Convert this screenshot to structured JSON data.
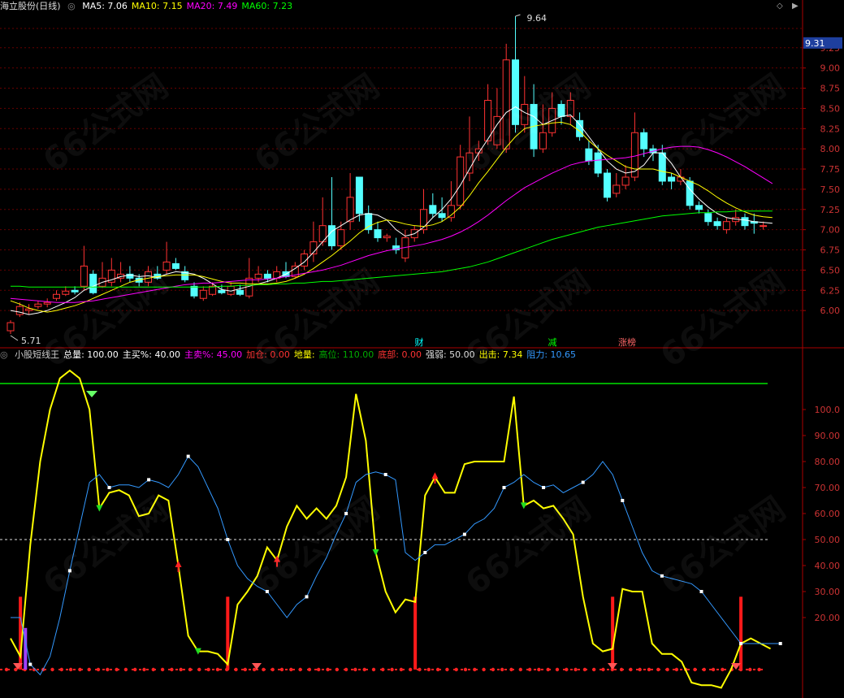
{
  "top_header": {
    "title": "海立股份(日线)",
    "ma_items": [
      {
        "label": "MA5: 7.06",
        "color": "#ffffff"
      },
      {
        "label": "MA10: 7.15",
        "color": "#ffff00"
      },
      {
        "label": "MA20: 7.49",
        "color": "#ff00ff"
      },
      {
        "label": "MA60: 7.23",
        "color": "#00ff00"
      }
    ]
  },
  "bottom_header": {
    "items": [
      {
        "label": "小股短线王",
        "color": "#cccccc"
      },
      {
        "label": "总量: 100.00",
        "color": "#ffffff"
      },
      {
        "label": "主买%: 40.00",
        "color": "#ffffff"
      },
      {
        "label": "主卖%: 45.00",
        "color": "#ff00ff"
      },
      {
        "label": "加仓: 0.00",
        "color": "#ff3333"
      },
      {
        "label": "地量:",
        "color": "#ffff00"
      },
      {
        "label": "高位: 110.00",
        "color": "#00aa00"
      },
      {
        "label": "底部: 0.00",
        "color": "#ff3333"
      },
      {
        "label": "强弱: 50.00",
        "color": "#dddddd"
      },
      {
        "label": "出击: 7.34",
        "color": "#ffff00"
      },
      {
        "label": "阻力: 10.65",
        "color": "#3399ff"
      }
    ]
  },
  "icons": {
    "diamond": "diamond-icon",
    "scroll_right": "scroll-right-icon",
    "circle": "circle-icon"
  },
  "watermark": "66公式网",
  "price_panel": {
    "current_price": "9.31",
    "high_label": "9.64",
    "low_label": "5.71",
    "y_ticks": [
      "9.25",
      "9.00",
      "8.75",
      "8.50",
      "8.25",
      "8.00",
      "7.75",
      "7.50",
      "7.25",
      "7.00",
      "6.75",
      "6.50",
      "6.25",
      "6.00"
    ],
    "event_markers": [
      {
        "text": "财",
        "color": "#00ffff"
      },
      {
        "text": "减",
        "color": "#00ff00"
      },
      {
        "text": "涨榜",
        "color": "#ff6666"
      }
    ]
  },
  "indicator_panel": {
    "y_ticks": [
      "100.0",
      "90.00",
      "80.00",
      "70.00",
      "60.00",
      "50.00",
      "40.00",
      "30.00",
      "20.00"
    ]
  },
  "chart_data": [
    {
      "type": "candlestick",
      "title": "海立股份(日线)",
      "ylim": [
        5.7,
        9.64
      ],
      "candles": [
        [
          5.75,
          5.85,
          5.71,
          5.88
        ],
        [
          5.95,
          6.05,
          5.92,
          6.1
        ],
        [
          6.0,
          6.02,
          5.95,
          6.08
        ],
        [
          6.05,
          6.08,
          6.02,
          6.12
        ],
        [
          6.08,
          6.1,
          6.04,
          6.15
        ],
        [
          6.15,
          6.2,
          6.12,
          6.25
        ],
        [
          6.2,
          6.24,
          6.18,
          6.3
        ],
        [
          6.25,
          6.23,
          6.2,
          6.3
        ],
        [
          6.3,
          6.55,
          6.25,
          6.8
        ],
        [
          6.45,
          6.22,
          6.2,
          6.5
        ],
        [
          6.3,
          6.4,
          6.28,
          6.6
        ],
        [
          6.35,
          6.5,
          6.3,
          6.65
        ],
        [
          6.4,
          6.45,
          6.35,
          6.6
        ],
        [
          6.45,
          6.4,
          6.35,
          6.55
        ],
        [
          6.4,
          6.35,
          6.3,
          6.45
        ],
        [
          6.35,
          6.48,
          6.3,
          6.55
        ],
        [
          6.45,
          6.4,
          6.38,
          6.55
        ],
        [
          6.5,
          6.6,
          6.45,
          6.85
        ],
        [
          6.58,
          6.52,
          6.5,
          6.65
        ],
        [
          6.48,
          6.38,
          6.35,
          6.55
        ],
        [
          6.3,
          6.18,
          6.15,
          6.35
        ],
        [
          6.15,
          6.25,
          6.12,
          6.3
        ],
        [
          6.2,
          6.3,
          6.18,
          6.35
        ],
        [
          6.25,
          6.22,
          6.2,
          6.32
        ],
        [
          6.2,
          6.3,
          6.18,
          6.35
        ],
        [
          6.25,
          6.2,
          6.18,
          6.32
        ],
        [
          6.18,
          6.4,
          6.15,
          6.65
        ],
        [
          6.4,
          6.45,
          6.35,
          6.55
        ],
        [
          6.45,
          6.4,
          6.35,
          6.5
        ],
        [
          6.4,
          6.48,
          6.35,
          6.55
        ],
        [
          6.48,
          6.42,
          6.4,
          6.6
        ],
        [
          6.42,
          6.55,
          6.4,
          6.6
        ],
        [
          6.55,
          6.7,
          6.5,
          6.75
        ],
        [
          6.7,
          6.85,
          6.6,
          7.1
        ],
        [
          6.85,
          7.05,
          6.8,
          7.4
        ],
        [
          7.05,
          6.8,
          6.75,
          7.65
        ],
        [
          6.8,
          7.0,
          6.75,
          7.1
        ],
        [
          7.1,
          7.4,
          7.0,
          7.7
        ],
        [
          7.65,
          7.2,
          7.1,
          7.65
        ],
        [
          7.2,
          7.0,
          6.95,
          7.3
        ],
        [
          7.0,
          6.9,
          6.85,
          7.1
        ],
        [
          6.9,
          6.92,
          6.85,
          6.95
        ],
        [
          6.8,
          6.75,
          6.7,
          6.9
        ],
        [
          6.65,
          6.9,
          6.6,
          7.0
        ],
        [
          6.9,
          7.0,
          6.85,
          7.05
        ],
        [
          7.0,
          7.25,
          6.95,
          7.5
        ],
        [
          7.3,
          7.2,
          7.15,
          7.45
        ],
        [
          7.2,
          7.15,
          7.1,
          7.4
        ],
        [
          7.15,
          7.3,
          7.1,
          7.6
        ],
        [
          7.3,
          7.9,
          7.25,
          8.05
        ],
        [
          7.7,
          7.95,
          7.6,
          8.4
        ],
        [
          7.95,
          8.0,
          7.85,
          8.1
        ],
        [
          8.1,
          8.6,
          8.05,
          8.8
        ],
        [
          8.05,
          8.4,
          8.0,
          8.75
        ],
        [
          8.0,
          9.1,
          7.95,
          9.3
        ],
        [
          9.1,
          8.3,
          8.2,
          9.64
        ],
        [
          8.3,
          8.55,
          8.2,
          8.9
        ],
        [
          8.55,
          8.0,
          7.9,
          8.8
        ],
        [
          8.0,
          8.2,
          7.95,
          8.55
        ],
        [
          8.2,
          8.5,
          8.15,
          8.7
        ],
        [
          8.55,
          8.4,
          8.3,
          8.6
        ],
        [
          8.4,
          8.6,
          8.3,
          8.7
        ],
        [
          8.35,
          8.15,
          8.1,
          8.45
        ],
        [
          8.0,
          7.85,
          7.8,
          8.1
        ],
        [
          7.95,
          7.7,
          7.65,
          8.05
        ],
        [
          7.7,
          7.4,
          7.35,
          7.75
        ],
        [
          7.45,
          7.55,
          7.4,
          7.7
        ],
        [
          7.55,
          7.65,
          7.5,
          7.8
        ],
        [
          7.65,
          8.2,
          7.6,
          8.45
        ],
        [
          8.2,
          8.0,
          7.9,
          8.25
        ],
        [
          8.0,
          7.95,
          7.85,
          8.05
        ],
        [
          7.95,
          7.6,
          7.55,
          8.05
        ],
        [
          7.65,
          7.6,
          7.5,
          7.7
        ],
        [
          7.6,
          7.65,
          7.55,
          7.75
        ],
        [
          7.6,
          7.3,
          7.25,
          7.65
        ],
        [
          7.3,
          7.25,
          7.2,
          7.35
        ],
        [
          7.2,
          7.1,
          7.05,
          7.25
        ],
        [
          7.1,
          7.05,
          7.0,
          7.15
        ],
        [
          7.0,
          7.1,
          6.95,
          7.15
        ],
        [
          7.1,
          7.15,
          7.05,
          7.25
        ],
        [
          7.15,
          7.05,
          7.0,
          7.2
        ],
        [
          7.1,
          7.08,
          6.95,
          7.2
        ],
        [
          7.05,
          7.05,
          7.0,
          7.1
        ]
      ],
      "series": [
        {
          "name": "MA5",
          "color": "#ffffff",
          "values": [
            6.0,
            5.98,
            5.95,
            5.97,
            6.0,
            6.05,
            6.1,
            6.16,
            6.25,
            6.3,
            6.35,
            6.38,
            6.42,
            6.44,
            6.42,
            6.43,
            6.41,
            6.45,
            6.48,
            6.47,
            6.45,
            6.4,
            6.33,
            6.26,
            6.24,
            6.27,
            6.3,
            6.33,
            6.36,
            6.4,
            6.45,
            6.52,
            6.6,
            6.72,
            6.85,
            6.98,
            7.05,
            7.12,
            7.18,
            7.2,
            7.18,
            7.12,
            7.0,
            6.92,
            6.95,
            7.03,
            7.15,
            7.25,
            7.38,
            7.55,
            7.75,
            7.95,
            8.12,
            8.3,
            8.45,
            8.52,
            8.45,
            8.4,
            8.3,
            8.35,
            8.4,
            8.42,
            8.3,
            8.15,
            8.0,
            7.85,
            7.75,
            7.7,
            7.72,
            7.8,
            7.95,
            7.95,
            7.82,
            7.65,
            7.5,
            7.38,
            7.28,
            7.2,
            7.15,
            7.13,
            7.12,
            7.1,
            7.09,
            7.08
          ]
        },
        {
          "name": "MA10",
          "color": "#ffff00",
          "values": [
            6.12,
            6.08,
            6.03,
            6.0,
            5.98,
            6.0,
            6.03,
            6.06,
            6.1,
            6.15,
            6.2,
            6.25,
            6.3,
            6.35,
            6.38,
            6.4,
            6.42,
            6.43,
            6.44,
            6.44,
            6.44,
            6.42,
            6.39,
            6.36,
            6.34,
            6.34,
            6.33,
            6.33,
            6.33,
            6.34,
            6.36,
            6.4,
            6.45,
            6.52,
            6.6,
            6.68,
            6.77,
            6.86,
            6.96,
            7.04,
            7.09,
            7.12,
            7.1,
            7.07,
            7.05,
            7.04,
            7.06,
            7.1,
            7.18,
            7.28,
            7.42,
            7.58,
            7.72,
            7.87,
            8.02,
            8.15,
            8.25,
            8.28,
            8.3,
            8.32,
            8.33,
            8.3,
            8.22,
            8.1,
            8.0,
            7.92,
            7.85,
            7.78,
            7.75,
            7.75,
            7.75,
            7.72,
            7.7,
            7.65,
            7.6,
            7.55,
            7.48,
            7.4,
            7.33,
            7.27,
            7.22,
            7.18,
            7.16,
            7.15
          ]
        },
        {
          "name": "MA20",
          "color": "#ff00ff",
          "values": [
            6.15,
            6.14,
            6.13,
            6.12,
            6.11,
            6.1,
            6.1,
            6.1,
            6.11,
            6.12,
            6.14,
            6.16,
            6.18,
            6.2,
            6.22,
            6.24,
            6.26,
            6.28,
            6.3,
            6.32,
            6.33,
            6.34,
            6.34,
            6.35,
            6.36,
            6.37,
            6.38,
            6.38,
            6.39,
            6.4,
            6.42,
            6.44,
            6.46,
            6.48,
            6.5,
            6.53,
            6.56,
            6.6,
            6.64,
            6.68,
            6.71,
            6.74,
            6.76,
            6.78,
            6.8,
            6.82,
            6.85,
            6.88,
            6.92,
            6.97,
            7.03,
            7.1,
            7.18,
            7.27,
            7.36,
            7.44,
            7.52,
            7.58,
            7.64,
            7.7,
            7.75,
            7.8,
            7.83,
            7.85,
            7.86,
            7.87,
            7.88,
            7.89,
            7.91,
            7.94,
            7.97,
            8.0,
            8.02,
            8.03,
            8.03,
            8.02,
            7.99,
            7.95,
            7.9,
            7.84,
            7.78,
            7.71,
            7.64,
            7.57
          ]
        },
        {
          "name": "MA60",
          "color": "#00ff00",
          "values": [
            6.3,
            6.3,
            6.29,
            6.29,
            6.29,
            6.29,
            6.29,
            6.29,
            6.29,
            6.29,
            6.29,
            6.29,
            6.29,
            6.29,
            6.29,
            6.29,
            6.29,
            6.29,
            6.29,
            6.29,
            6.29,
            6.29,
            6.29,
            6.3,
            6.3,
            6.31,
            6.31,
            6.32,
            6.32,
            6.33,
            6.33,
            6.34,
            6.34,
            6.35,
            6.36,
            6.36,
            6.37,
            6.38,
            6.39,
            6.4,
            6.41,
            6.42,
            6.43,
            6.44,
            6.45,
            6.46,
            6.47,
            6.48,
            6.5,
            6.52,
            6.54,
            6.57,
            6.6,
            6.64,
            6.68,
            6.72,
            6.76,
            6.8,
            6.84,
            6.88,
            6.91,
            6.94,
            6.97,
            7.0,
            7.03,
            7.05,
            7.07,
            7.09,
            7.11,
            7.13,
            7.15,
            7.17,
            7.18,
            7.19,
            7.2,
            7.21,
            7.21,
            7.22,
            7.22,
            7.23,
            7.23,
            7.23,
            7.23,
            7.23
          ]
        }
      ]
    },
    {
      "type": "line",
      "title": "小股短线王",
      "ylim": [
        0,
        115
      ],
      "reference_lines": {
        "high": 110,
        "mid": 50,
        "bottom": 0
      },
      "series": [
        {
          "name": "出击",
          "color": "#ffff00",
          "values": [
            12,
            5,
            48,
            80,
            100,
            112,
            115,
            112,
            100,
            62,
            68,
            69,
            67,
            59,
            60,
            67,
            65,
            40,
            13,
            7,
            7,
            6,
            2,
            25,
            30,
            36,
            47,
            42,
            55,
            63,
            58,
            62,
            58,
            63,
            74,
            106,
            88,
            45,
            30,
            22,
            27,
            26,
            67,
            74,
            68,
            68,
            79,
            80,
            80,
            80,
            80,
            105,
            63,
            65,
            62,
            63,
            58,
            52,
            28,
            10,
            7,
            8,
            31,
            30,
            30,
            10,
            6,
            6,
            3,
            -5,
            -6,
            -6,
            -7,
            0,
            10,
            12,
            10,
            8
          ]
        },
        {
          "name": "阻力",
          "color": "#3399ff",
          "values": [
            20,
            20,
            2,
            -2,
            5,
            20,
            38,
            55,
            72,
            75,
            70,
            71,
            71,
            70,
            73,
            72,
            70,
            75,
            82,
            78,
            70,
            62,
            50,
            40,
            35,
            32,
            30,
            25,
            20,
            25,
            28,
            36,
            43,
            52,
            60,
            72,
            75,
            76,
            75,
            73,
            45,
            42,
            45,
            48,
            48,
            50,
            52,
            56,
            58,
            62,
            70,
            72,
            75,
            72,
            70,
            71,
            68,
            70,
            72,
            75,
            80,
            75,
            65,
            55,
            45,
            38,
            36,
            35,
            34,
            33,
            30,
            25,
            20,
            15,
            10,
            10,
            10,
            10,
            10
          ]
        }
      ],
      "red_bars_index": [
        1,
        22,
        41,
        61,
        74
      ],
      "purple_bar_index": 2,
      "down_arrows_green_index": [
        9,
        19,
        37,
        52
      ],
      "up_arrows_red_index": [
        17,
        27,
        43
      ]
    }
  ]
}
